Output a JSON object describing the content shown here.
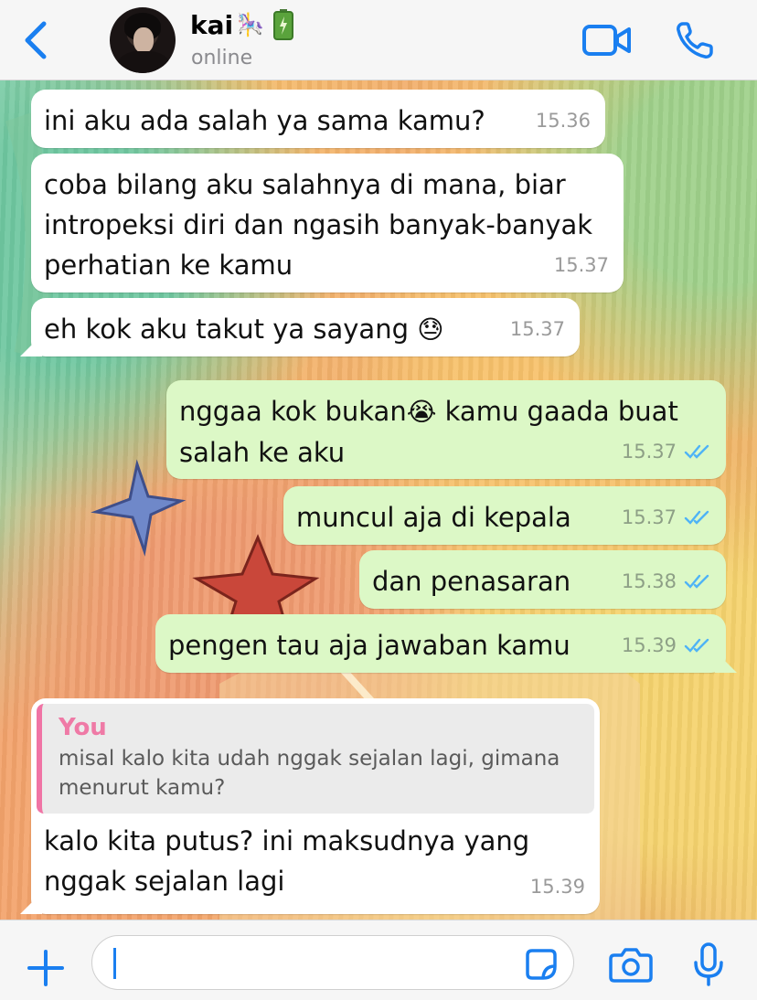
{
  "header": {
    "contact_name": "kai",
    "name_emoji": "🎠",
    "status": "online",
    "accent_color": "#1a7ff0"
  },
  "messages": [
    {
      "direction": "incoming",
      "text": "ini aku ada salah ya sama kamu?",
      "time": "15.36"
    },
    {
      "direction": "incoming",
      "text": "coba bilang aku salahnya di mana, biar intropeksi diri dan ngasih banyak-banyak perhatian ke kamu",
      "time": "15.37"
    },
    {
      "direction": "incoming",
      "text": "eh kok aku takut ya sayang",
      "emoji": "😓",
      "time": "15.37"
    },
    {
      "direction": "outgoing",
      "text": "nggaa kok bukan",
      "emoji": "😭",
      "text_after": " kamu gaada buat salah ke aku",
      "time": "15.37",
      "status": "read"
    },
    {
      "direction": "outgoing",
      "text": "muncul aja di kepala",
      "time": "15.37",
      "status": "read"
    },
    {
      "direction": "outgoing",
      "text": "dan penasaran",
      "time": "15.38",
      "status": "read"
    },
    {
      "direction": "outgoing",
      "text": "pengen tau aja jawaban kamu",
      "time": "15.39",
      "status": "read"
    },
    {
      "direction": "incoming",
      "quote": {
        "author": "You",
        "text": "misal kalo kita udah nggak sejalan lagi, gimana menurut kamu?"
      },
      "text": "kalo kita putus? ini maksudnya yang nggak sejalan lagi",
      "time": "15.39"
    }
  ],
  "input": {
    "placeholder": ""
  },
  "icons": {
    "back": "chevron-left-icon",
    "video": "video-camera-icon",
    "call": "phone-icon",
    "plus": "plus-icon",
    "sticker": "sticker-icon",
    "camera": "camera-icon",
    "mic": "microphone-icon"
  }
}
